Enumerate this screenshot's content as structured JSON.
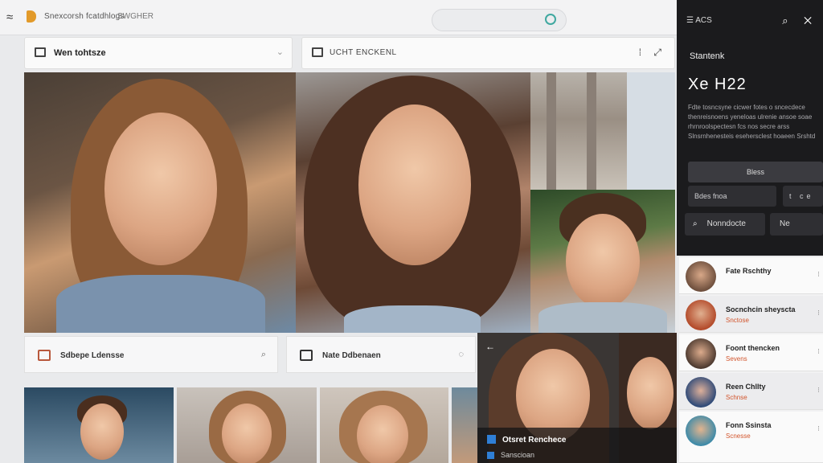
{
  "topbar": {
    "app_title": "Snexcorsh fcatdhlogs",
    "app_sub": "SWGHER"
  },
  "toolbar": {
    "left_label": "Wen tohtsze",
    "right_label": "UCHT ENCKENL"
  },
  "infobars": {
    "left_label": "Sdbepe Ldensse",
    "right_label": "Nate Ddbenaen"
  },
  "video": {
    "caption": "Otsret Renchece",
    "subcaption": "Sanscioan"
  },
  "panel": {
    "header": "ACS",
    "subtitle": "Stantenk",
    "number": "Xe H22",
    "description": "Fdte tosncsyne cicwer fotes o sncecdece thenreisnoens yeneloas ulrenie ansoe soae rhrnroolspectesn fcs nos secre arss Slnsrnhenesteis esehersclest hoaeen Srshtd",
    "button": "Bless",
    "field1": "Bdes fnoa",
    "field2": "t ce",
    "search": "Nonndocte",
    "field3": "Ne"
  },
  "users": [
    {
      "name": "Fate Rschthy",
      "meta": ""
    },
    {
      "name": "Socnchcin sheyscta",
      "meta": "Snctose"
    },
    {
      "name": "Foont thencken",
      "meta": "Sevens"
    },
    {
      "name": "Reen Chllty",
      "meta": "Schnse"
    },
    {
      "name": "Fonn Ssinsta",
      "meta": "Scnesse"
    }
  ],
  "colors": {
    "accent_orange": "#d2552d",
    "panel_dark": "#1b1b1d",
    "logo_orange": "#e29a2a",
    "search_teal": "#3fa8a0"
  }
}
